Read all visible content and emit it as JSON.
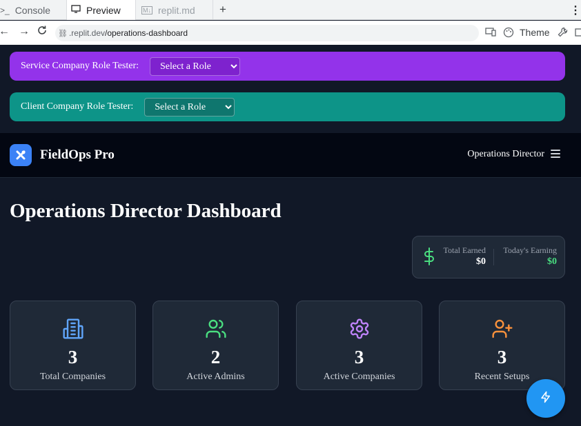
{
  "browser": {
    "tabs": [
      {
        "label": "Console",
        "icon": "terminal-icon"
      },
      {
        "label": "Preview",
        "icon": "monitor-icon"
      },
      {
        "label": "replit.md",
        "icon": "markdown-icon"
      }
    ],
    "url_domain": ".replit.dev",
    "url_path": "/operations-dashboard",
    "theme_label": "Theme"
  },
  "role_testers": {
    "service": {
      "label": "Service Company Role Tester:",
      "select_value": "Select a Role"
    },
    "client": {
      "label": "Client Company Role Tester:",
      "select_value": "Select a Role"
    }
  },
  "header": {
    "brand": "FieldOps Pro",
    "role": "Operations Director"
  },
  "page": {
    "title": "Operations Director Dashboard"
  },
  "earnings": {
    "total_label": "Total Earned",
    "total_value": "$0",
    "today_label": "Today's Earning",
    "today_value": "$0"
  },
  "stats": [
    {
      "value": "3",
      "label": "Total Companies",
      "icon": "building-icon",
      "color": "#60a5fa"
    },
    {
      "value": "2",
      "label": "Active Admins",
      "icon": "users-icon",
      "color": "#4ade80"
    },
    {
      "value": "3",
      "label": "Active Companies",
      "icon": "gear-icon",
      "color": "#c084fc"
    },
    {
      "value": "3",
      "label": "Recent Setups",
      "icon": "user-plus-icon",
      "color": "#fb923c"
    }
  ],
  "colors": {
    "service_tester": "#9333ea",
    "client_tester": "#0d9488",
    "accent": "#3b82f6",
    "fab": "#2196f3",
    "earnings_green": "#4ade80"
  }
}
